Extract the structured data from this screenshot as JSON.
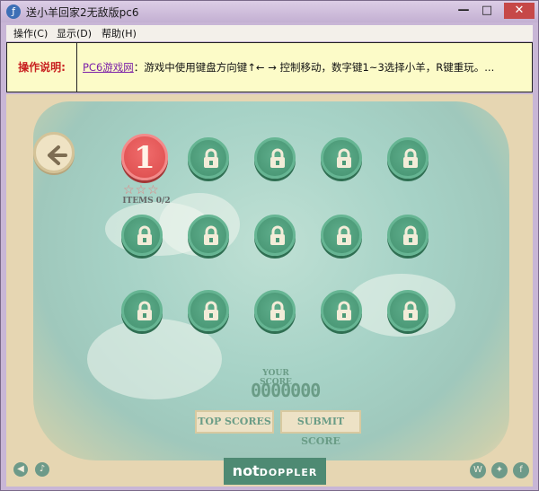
{
  "window": {
    "title": "送小羊回家2无敌版pc6",
    "minimize": "—",
    "maximize": "□",
    "close": "✕"
  },
  "menu": {
    "items": [
      {
        "label": "操作(C)"
      },
      {
        "label": "显示(D)"
      },
      {
        "label": "帮助(H)"
      }
    ]
  },
  "instructions": {
    "label": "操作说明:",
    "link": "PC6游戏网",
    "text": "：游戏中使用键盘方向键↑← → 控制移动，数字键1~3选择小羊，R键重玩。..."
  },
  "game": {
    "back_icon": "left-arrow-icon",
    "levels": [
      {
        "number": "1",
        "locked": false
      },
      {
        "locked": true
      },
      {
        "locked": true
      },
      {
        "locked": true
      },
      {
        "locked": true
      },
      {
        "locked": true
      },
      {
        "locked": true
      },
      {
        "locked": true
      },
      {
        "locked": true
      },
      {
        "locked": true
      },
      {
        "locked": true
      },
      {
        "locked": true
      },
      {
        "locked": true
      },
      {
        "locked": true
      },
      {
        "locked": true
      }
    ],
    "level1_stars": 0,
    "level1_stars_max": 3,
    "level1_items": "ITEMS 0/2",
    "score_label": "YOUR SCORE",
    "score_value": "0000000",
    "top_scores_label": "TOP SCORES",
    "submit_score_label": "SUBMIT SCORE",
    "logo_not": "not",
    "logo_doppler": "DOPPLER",
    "colors": {
      "locked_level": "#4c9a78",
      "unlocked_level": "#e25555",
      "accent_text": "#6a9c86"
    }
  }
}
